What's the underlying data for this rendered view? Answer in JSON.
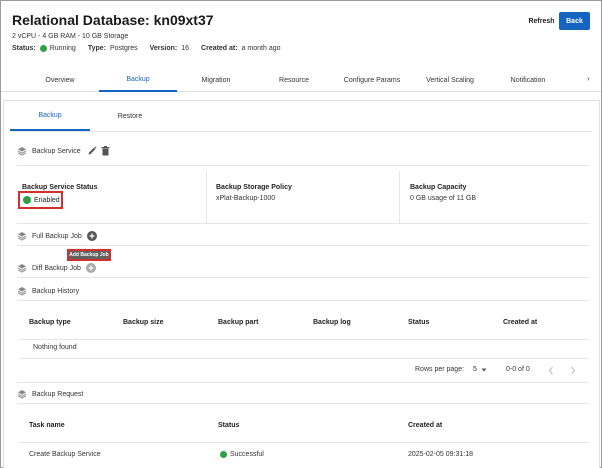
{
  "header": {
    "title": "Relational Database: kn09xt37",
    "specs": "2 vCPU - 4 GB RAM - 10 GB Storage",
    "status_label": "Status:",
    "status_value": "Running",
    "type_label": "Type:",
    "type_value": "Postgres",
    "version_label": "Version:",
    "version_value": "16",
    "created_label": "Created at:",
    "created_value": "a month ago",
    "refresh_label": "Refresh",
    "back_label": "Back"
  },
  "tabs": [
    "Overview",
    "Backup",
    "Migration",
    "Resource",
    "Configure Params",
    "Vertical Scaling",
    "Notification"
  ],
  "active_tab": "Backup",
  "subtabs": [
    "Backup",
    "Restore"
  ],
  "backup_service": {
    "title": "Backup Service",
    "status_header": "Backup Service Status",
    "status_value": "Enabled",
    "policy_header": "Backup Storage Policy",
    "policy_value": "xPlat-Backup-1000",
    "capacity_header": "Backup Capacity",
    "capacity_value": "0 GB usage of 11 GB"
  },
  "full_backup_job": {
    "title": "Full Backup Job",
    "tooltip": "Add Backup Job"
  },
  "diff_backup_job": {
    "title": "Diff Backup Job"
  },
  "backup_history": {
    "title": "Backup History",
    "columns": [
      "Backup type",
      "Backup size",
      "Backup part",
      "Backup log",
      "Status",
      "Created at"
    ],
    "empty_text": "Nothing found",
    "rows_per_page_label": "Rows per page:",
    "rows_per_page_value": "5",
    "range_text": "0-0 of 0"
  },
  "backup_request": {
    "title": "Backup Request",
    "columns": [
      "Task name",
      "Status",
      "Created at"
    ],
    "rows": [
      {
        "task": "Create Backup Service",
        "status": "Successful",
        "created": "2025-02-05 09:31:18"
      }
    ]
  },
  "colors": {
    "accent": "#1565c0",
    "success": "#2ea043",
    "highlight": "#d32f2f"
  }
}
